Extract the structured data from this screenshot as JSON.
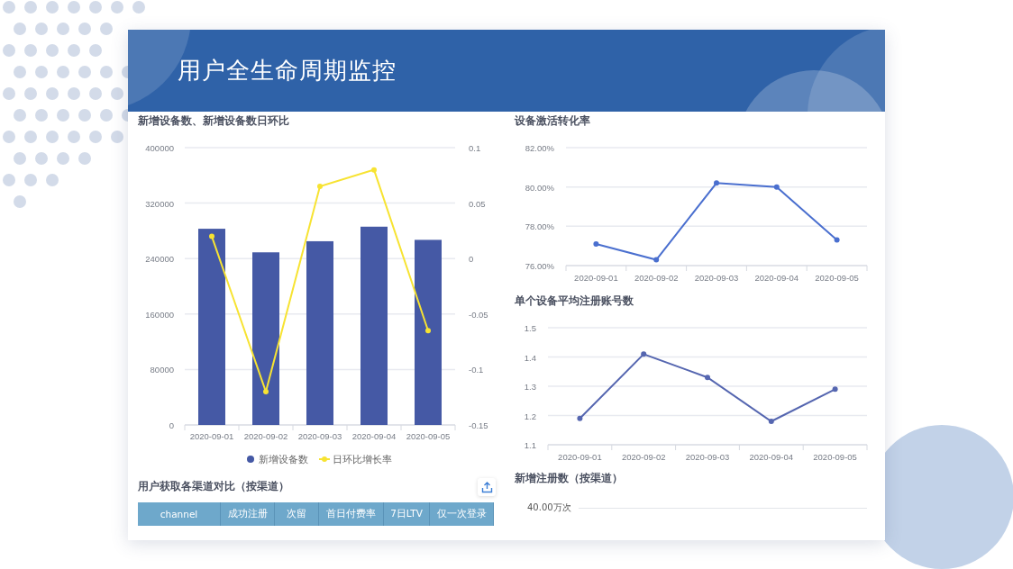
{
  "header": {
    "title": "用户全生命周期监控"
  },
  "device_chart": {
    "title": "新增设备数、新增设备数日环比",
    "chart_data": {
      "type": "bar",
      "grid": true,
      "legend": "bottom",
      "categories": [
        "2020-09-01",
        "2020-09-02",
        "2020-09-03",
        "2020-09-04",
        "2020-09-05"
      ],
      "ylim": [
        0,
        400000
      ],
      "yticks": [
        0,
        80000,
        160000,
        240000,
        320000,
        400000
      ],
      "y2lim": [
        -0.15,
        0.1
      ],
      "y2ticks": [
        -0.15,
        -0.1,
        -0.05,
        0,
        0.05,
        0.1
      ],
      "series": [
        {
          "name": "新增设备数",
          "type": "bar",
          "color": "#4559a5",
          "values": [
            283000,
            249000,
            265000,
            286000,
            267000
          ]
        },
        {
          "name": "日环比增长率",
          "type": "line",
          "axis": "y2",
          "marker": "circle",
          "color": "#f7e332",
          "values": [
            0.02,
            -0.12,
            0.065,
            0.08,
            -0.065
          ]
        }
      ]
    }
  },
  "activation_chart": {
    "title": "设备激活转化率",
    "chart_data": {
      "type": "line",
      "grid": true,
      "categories": [
        "2020-09-01",
        "2020-09-02",
        "2020-09-03",
        "2020-09-04",
        "2020-09-05"
      ],
      "ylim": [
        76,
        82
      ],
      "yticks": [
        {
          "value": 76,
          "label": "76.00%"
        },
        {
          "value": 78,
          "label": "78.00%"
        },
        {
          "value": 80,
          "label": "80.00%"
        },
        {
          "value": 82,
          "label": "82.00%"
        }
      ],
      "series": [
        {
          "marker": "circle",
          "color": "#4a6fcf",
          "values": [
            77.1,
            76.3,
            80.2,
            80.0,
            77.3
          ]
        }
      ]
    }
  },
  "accounts_chart": {
    "title": "单个设备平均注册账号数",
    "chart_data": {
      "type": "line",
      "grid": true,
      "categories": [
        "2020-09-01",
        "2020-09-02",
        "2020-09-03",
        "2020-09-04",
        "2020-09-05"
      ],
      "ylim": [
        1.1,
        1.5
      ],
      "yticks": [
        1.1,
        1.2,
        1.3,
        1.4,
        1.5
      ],
      "series": [
        {
          "marker": "circle",
          "color": "#5566b0",
          "values": [
            1.19,
            1.41,
            1.33,
            1.18,
            1.29
          ]
        }
      ]
    }
  },
  "channel_table": {
    "title": "用户获取各渠道对比（按渠道）",
    "columns": [
      "channel",
      "成功注册",
      "次留",
      "首日付费率",
      "7日LTV",
      "仅一次登录"
    ]
  },
  "registrations_chart": {
    "title": "新增注册数（按渠道）",
    "y_tick_label": "40.00万次"
  }
}
